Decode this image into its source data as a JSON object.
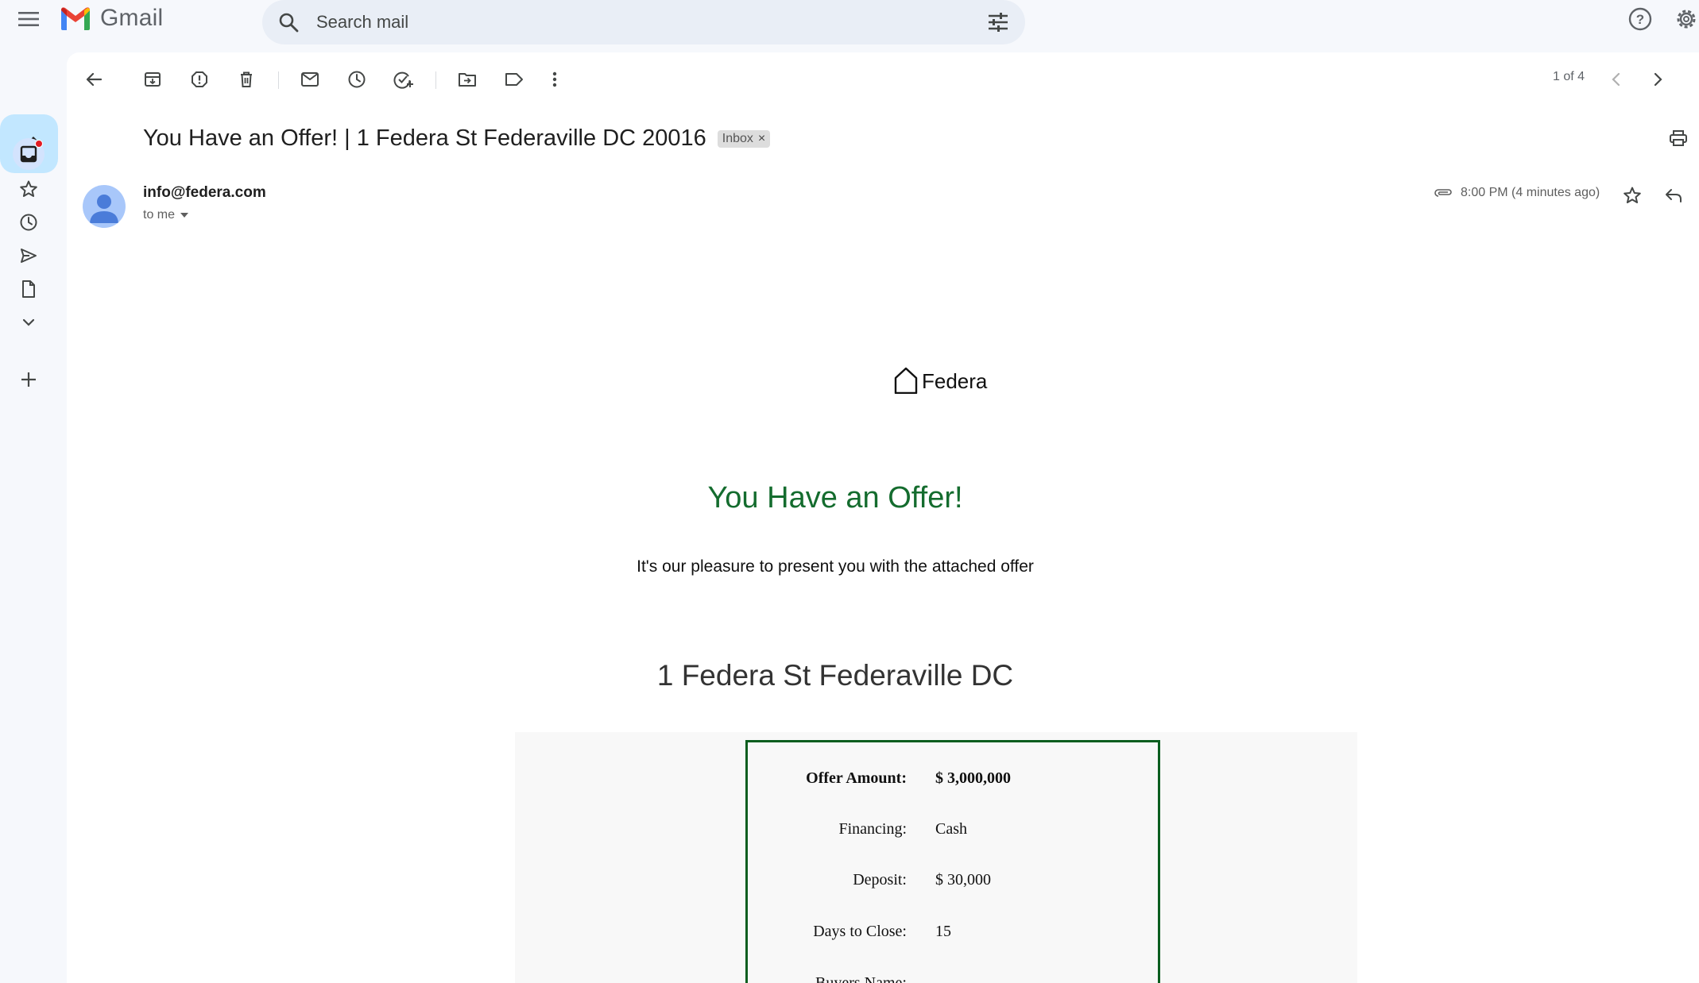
{
  "app": {
    "name": "Gmail"
  },
  "search": {
    "placeholder": "Search mail"
  },
  "toolbar": {
    "pager": "1 of 4"
  },
  "email": {
    "subject": "You Have an Offer! | 1 Federa St Federaville DC 20016",
    "label_chip": "Inbox",
    "chip_remove": "×",
    "sender": "info@federa.com",
    "recipient": "to me",
    "time": "8:00 PM (4 minutes ago)"
  },
  "content": {
    "brand": "Federa",
    "headline": "You Have an Offer!",
    "intro": "It's our pleasure to present you with the attached offer",
    "address": "1 Federa St Federaville DC",
    "offer": [
      {
        "label": "Offer Amount:",
        "value": "$ 3,000,000"
      },
      {
        "label": "Financing:",
        "value": "Cash"
      },
      {
        "label": "Deposit:",
        "value": "$ 30,000"
      },
      {
        "label": "Days to Close:",
        "value": "15"
      },
      {
        "label": "Buyers Name:",
        "value": ""
      }
    ]
  },
  "colors": {
    "headline_green": "#146c2e",
    "offer_border": "#0b5e1f",
    "compose_bg": "#c2e7ff",
    "unread_dot": "#e21b23"
  },
  "icons": [
    "menu-icon",
    "gmail-logo-icon",
    "search-icon",
    "filter-options-icon",
    "help-icon",
    "settings-icon",
    "pencil-icon",
    "inbox-icon",
    "star-icon",
    "clock-icon",
    "send-icon",
    "draft-icon",
    "chevron-down-icon",
    "plus-icon",
    "back-arrow-icon",
    "archive-icon",
    "report-spam-icon",
    "trash-icon",
    "mail-icon",
    "snooze-icon",
    "add-task-icon",
    "move-to-icon",
    "label-icon",
    "more-vert-icon",
    "chevron-left-icon",
    "chevron-right-icon",
    "print-icon",
    "attachment-icon",
    "reply-icon",
    "house-icon"
  ]
}
